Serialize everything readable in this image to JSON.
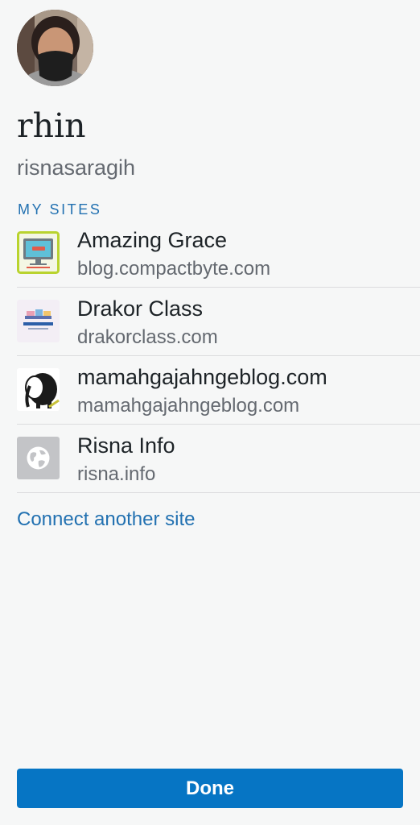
{
  "profile": {
    "display_name": "rhin",
    "username": "risnasaragih",
    "avatar_icon": "user-avatar-photo"
  },
  "my_sites": {
    "header": "MY SITES",
    "sites": [
      {
        "title": "Amazing Grace",
        "url": "blog.compactbyte.com",
        "icon": "monitor-icon"
      },
      {
        "title": "Drakor Class",
        "url": "drakorclass.com",
        "icon": "drakorclass-logo-icon"
      },
      {
        "title": "mamahgajahngeblog.com",
        "url": "mamahgajahngeblog.com",
        "icon": "elephant-icon"
      },
      {
        "title": "Risna Info",
        "url": "risna.info",
        "icon": "globe-icon"
      }
    ]
  },
  "connect_link": "Connect another site",
  "done_label": "Done",
  "colors": {
    "accent": "#2271b1",
    "button": "#0675c4",
    "background": "#f6f7f7",
    "secondary_text": "#646970",
    "divider": "#dcdcde"
  }
}
